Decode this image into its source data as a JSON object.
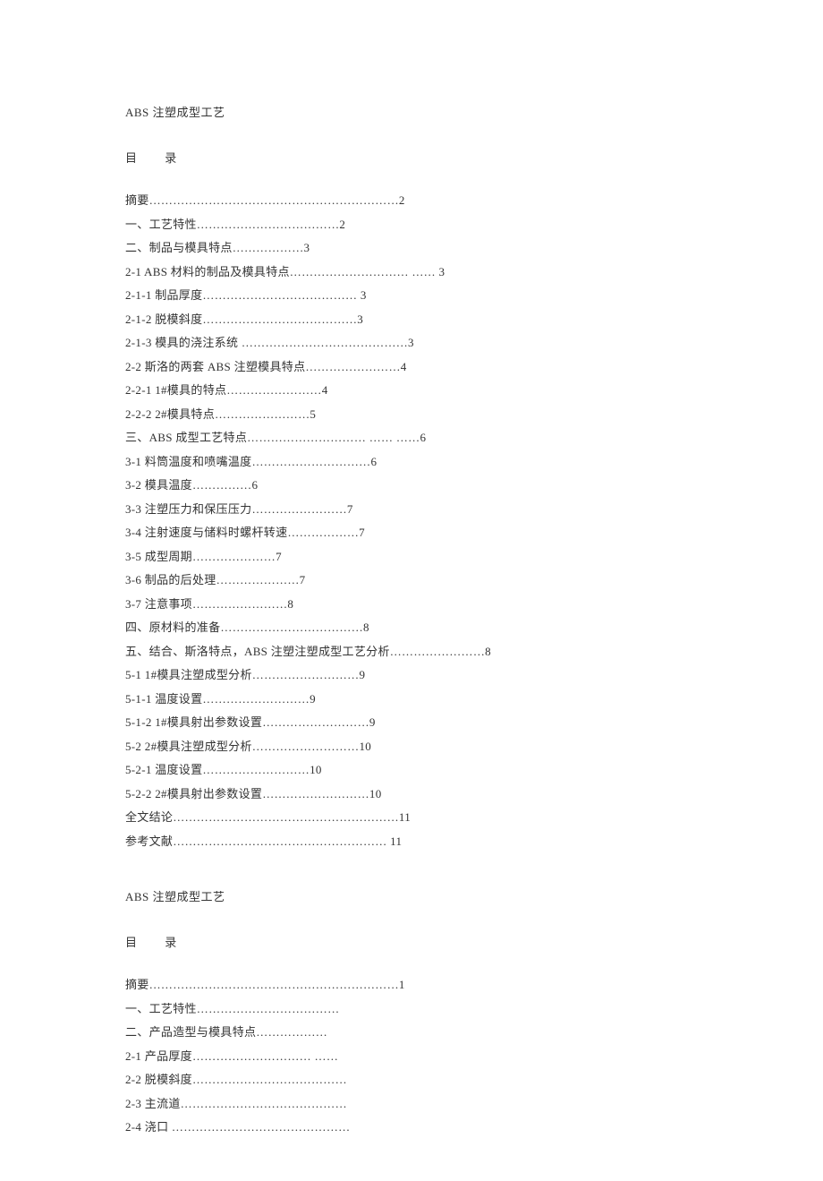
{
  "doc1": {
    "title": "ABS 注塑成型工艺",
    "toc_heading": "目 录",
    "entries": [
      "摘要………………………………………………………2",
      "一、工艺特性………………………………2",
      "二、制品与模具特点………………3",
      "2-1 ABS 材料的制品及模具特点…………………………  ……  3",
      "2-1-1    制品厚度…………………………………  3",
      "2-1-2    脱模斜度…………………………………3",
      "2-1-3     模具的浇注系统 ……………………………………3",
      "2-2  斯洛的两套 ABS 注塑模具特点……………………4",
      "2-2-1   1#模具的特点……………………4",
      "2-2-2   2#模具特点……………………5",
      "三、ABS 成型工艺特点…………………………  ……  ……6",
      "3-1    料筒温度和喷嘴温度…………………………6",
      "3-2    模具温度……………6",
      "3-3    注塑压力和保压压力……………………7",
      "3-4    注射速度与储料时螺杆转速………………7",
      "3-5    成型周期…………………7",
      "3-6    制品的后处理…………………7",
      "3-7    注意事项……………………8",
      "四、原材料的准备………………………………8",
      "五、结合、斯洛特点，ABS 注塑注塑成型工艺分析……………………8",
      "5-1 1#模具注塑成型分析………………………9",
      "5-1-1  温度设置………………………9",
      "5-1-2 1#模具射出参数设置………………………9",
      "5-2 2#模具注塑成型分析………………………10",
      "5-2-1  温度设置………………………10",
      "5-2-2 2#模具射出参数设置………………………10",
      "全文结论…………………………………………………11",
      "参考文献………………………………………………  11"
    ]
  },
  "doc2": {
    "title": "ABS 注塑成型工艺",
    "toc_heading": "目 录",
    "entries": [
      "摘要………………………………………………………1",
      "一、工艺特性………………………………",
      "二、产品造型与模具特点………………",
      "2-1   产品厚度…………………………  ……",
      "2-2    脱模斜度…………………………………",
      "2-3    主流道……………………………………",
      "2-4    浇口 ………………………………………"
    ]
  }
}
